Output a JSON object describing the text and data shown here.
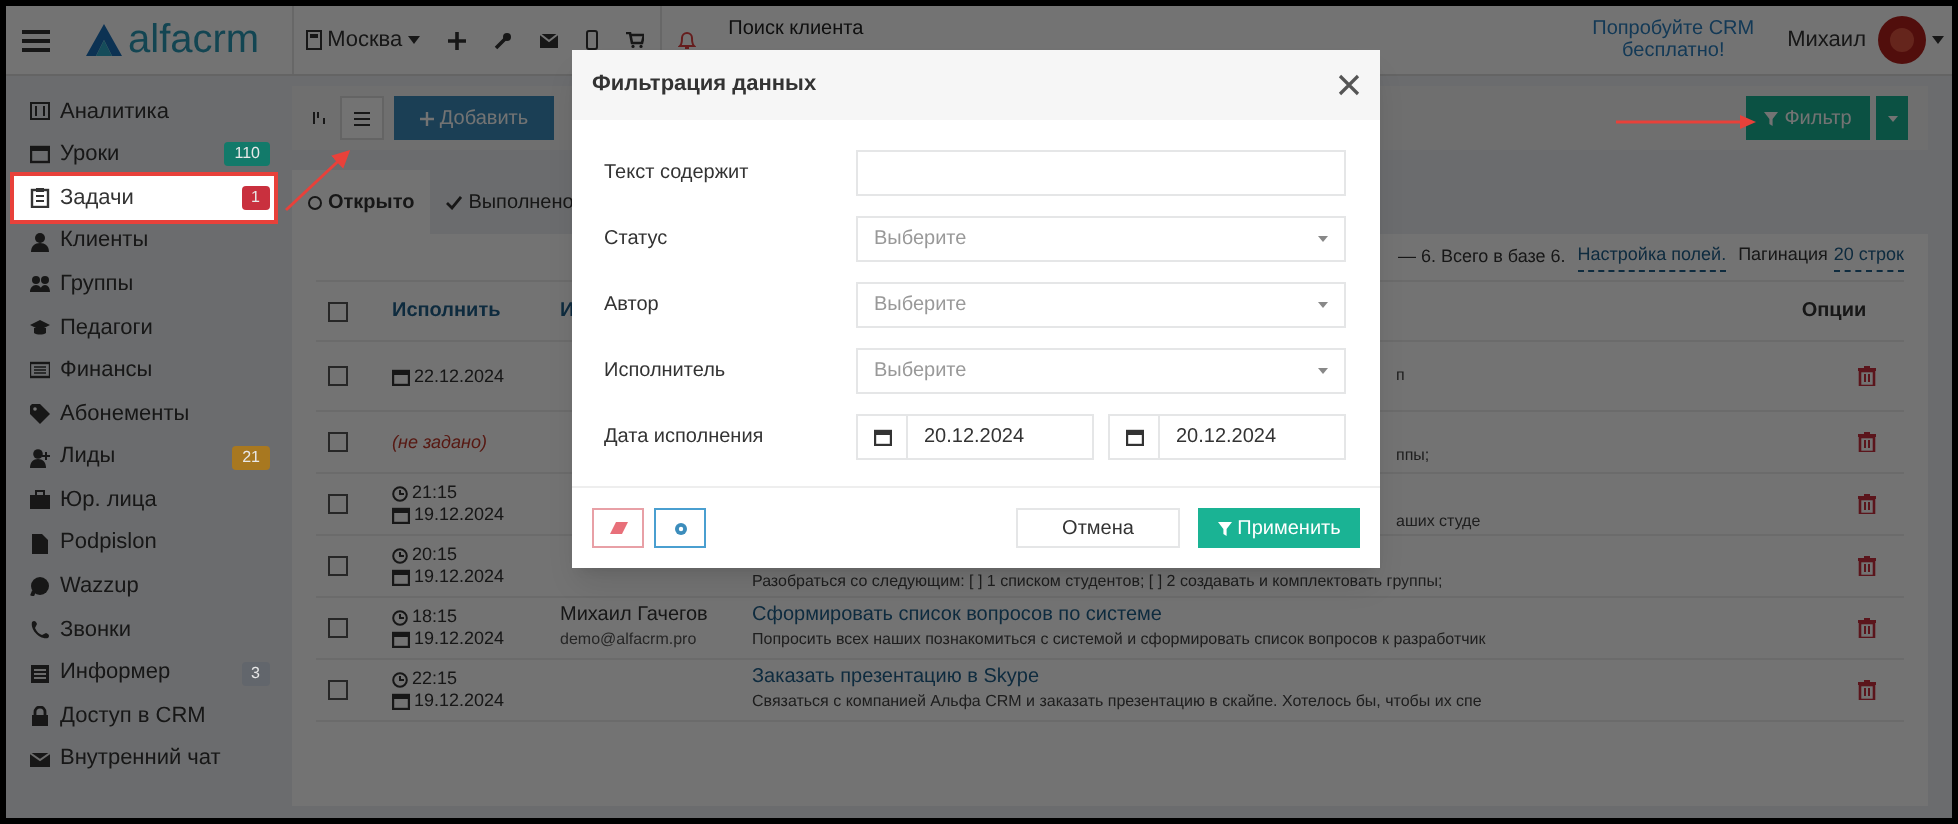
{
  "header": {
    "logo": "alfacrm",
    "branch": "Москва",
    "search": {
      "placeholder": "Поиск клиента"
    },
    "promo": "Попробуйте CRM бесплатно!",
    "user": "Михаил"
  },
  "sidebar": {
    "items": [
      {
        "label": "Аналитика",
        "annotated": false
      },
      {
        "label": "Уроки",
        "annotated": false,
        "badge": "110",
        "color": "#127a6a"
      },
      {
        "label": "Задачи",
        "annotated": true,
        "badge": "1",
        "color": "#c9303e"
      },
      {
        "label": "Клиенты",
        "annotated": false
      },
      {
        "label": "Группы",
        "annotated": false
      },
      {
        "label": "Педагоги",
        "annotated": false
      },
      {
        "label": "Финансы",
        "annotated": false
      },
      {
        "label": "Абонементы",
        "annotated": false
      },
      {
        "label": "Лиды",
        "annotated": false,
        "badge": "21",
        "color": "#a87820"
      },
      {
        "label": "Юр. лица",
        "annotated": false
      },
      {
        "label": "Podpislon",
        "annotated": false
      },
      {
        "label": "Wazzup",
        "annotated": false
      },
      {
        "label": "Звонки",
        "annotated": false
      },
      {
        "label": "Информер",
        "annotated": false,
        "badge": "3",
        "color": "#62666c"
      },
      {
        "label": "Доступ в CRM",
        "annotated": false
      },
      {
        "label": "Внутренний чат",
        "annotated": false
      }
    ]
  },
  "toolbar": {
    "add_button": "Добавить",
    "filter_button": "Фильтр"
  },
  "tabs": [
    {
      "label": "Открыто",
      "selected": true
    },
    {
      "label": "Выполнено",
      "selected": false
    }
  ],
  "summary": {
    "text": "— 6. Всего в базе 6.",
    "fields_link": "Настройка полей.",
    "pagination_label": "Пагинация",
    "pagination_link": "20 строк"
  },
  "table": {
    "select_all_checked": false,
    "columns": [
      "Исполнить",
      "И"
    ],
    "options_column": "Опции",
    "rows": [
      {
        "checked": false,
        "date": "22.12.2024",
        "description_tail": "п"
      },
      {
        "checked": false,
        "unset": "(не задано)",
        "description_tail": "ппы;"
      },
      {
        "checked": false,
        "time": "21:15",
        "date": "19.12.2024",
        "description_tail": "аших студе"
      },
      {
        "checked": false,
        "time": "20:15",
        "date": "19.12.2024",
        "description": "Разобраться со следующим: [ ] 1 списком студентов; [ ] 2 создавать и комплектовать группы;"
      },
      {
        "checked": false,
        "time": "18:15",
        "date": "19.12.2024",
        "author": "Михаил Гачегов",
        "email": "demo@alfacrm.pro",
        "title": "Сформировать список вопросов по системе",
        "description": "Попросить всех наших познакомиться с системой и сформировать список вопросов к разработчик"
      },
      {
        "checked": false,
        "time": "22:15",
        "date": "19.12.2024",
        "title": "Заказать презентацию в Skype",
        "description": "Связаться с компанией Альфа CRM и заказать презентацию в скайпе. Хотелось бы, чтобы их спе"
      }
    ]
  },
  "modal": {
    "title": "Фильтрация данных",
    "fields": [
      {
        "kind": "text",
        "label": "Текст содержит"
      },
      {
        "kind": "select",
        "label": "Статус",
        "placeholder": "Выберите"
      },
      {
        "kind": "select",
        "label": "Автор",
        "placeholder": "Выберите"
      },
      {
        "kind": "select",
        "label": "Исполнитель",
        "placeholder": "Выберите"
      },
      {
        "kind": "daterange",
        "label": "Дата исполнения",
        "from": "20.12.2024",
        "to": "20.12.2024"
      }
    ],
    "cancel_button": "Отмена",
    "apply_button": "Применить"
  }
}
